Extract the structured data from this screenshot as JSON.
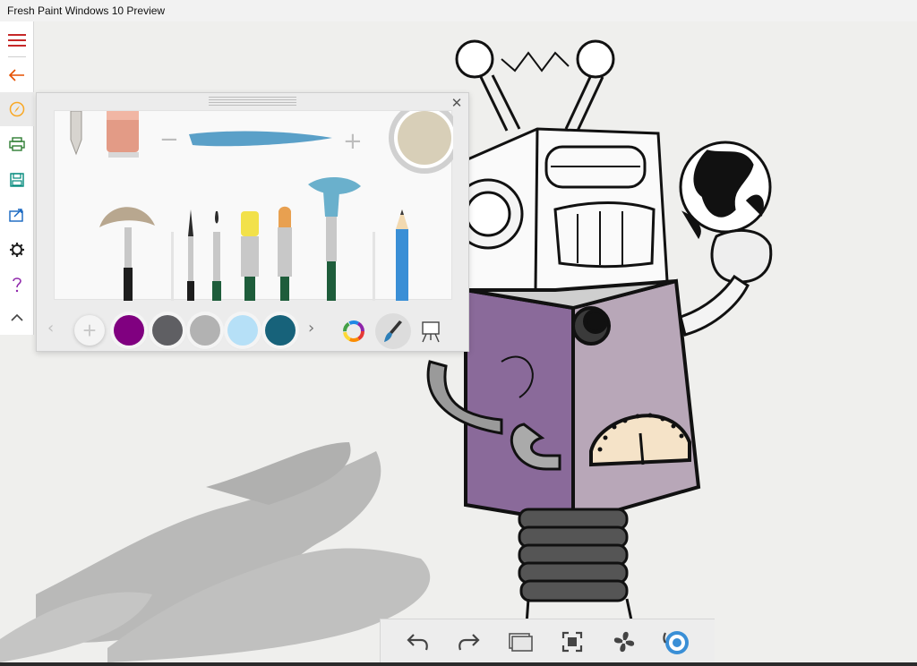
{
  "window": {
    "title": "Fresh Paint Windows 10 Preview"
  },
  "sidebar": {
    "items": [
      {
        "name": "menu",
        "icon": "hamburger-menu-icon",
        "color": "#c62828"
      },
      {
        "name": "back",
        "icon": "back-arrow-icon",
        "color": "#e65100"
      },
      {
        "name": "tools",
        "icon": "compass-icon",
        "color": "#f9a825"
      },
      {
        "name": "print",
        "icon": "printer-icon",
        "color": "#2e7d32"
      },
      {
        "name": "save",
        "icon": "save-icon",
        "color": "#00897b"
      },
      {
        "name": "share",
        "icon": "share-icon",
        "color": "#1565c0"
      },
      {
        "name": "settings",
        "icon": "gear-icon",
        "color": "#222222"
      },
      {
        "name": "help",
        "icon": "question-icon",
        "color": "#8e24aa"
      },
      {
        "name": "collapse",
        "icon": "chevron-up-icon",
        "color": "#444444"
      }
    ]
  },
  "tool_panel": {
    "close_glyph": "✕",
    "selected_color": "#d8cfb8",
    "stroke_color": "#5aa0c8",
    "size_minus": "−",
    "size_plus": "+",
    "brushes": [
      {
        "name": "fan-brush",
        "tip": "#b8a78f",
        "handle": "#1e1e1e"
      },
      {
        "name": "thin-brush",
        "tip": "#2b2b2b",
        "handle": "#f4f4f4"
      },
      {
        "name": "liner-brush",
        "tip": "#2b2b2b",
        "handle": "#1e5d3b"
      },
      {
        "name": "round-brush",
        "tip": "#e8e3d6",
        "handle": "#1e5d3b"
      },
      {
        "name": "flat-brush",
        "tip": "#f2e14a",
        "handle": "#1e5d3b"
      },
      {
        "name": "filbert-brush",
        "tip": "#e8a050",
        "handle": "#1e5d3b"
      },
      {
        "name": "blender-brush",
        "tip": "#6ab0cc",
        "handle": "#1e5d3b"
      },
      {
        "name": "pencil",
        "tip": "#3a3a3a",
        "handle": "#3a8fd6"
      }
    ],
    "palette": {
      "add_label": "+",
      "prev_arrow": "‹",
      "next_arrow": "›",
      "colors": [
        "#800080",
        "#5f5f63",
        "#b2b2b2",
        "#b6e0f7",
        "#17627a"
      ]
    }
  },
  "bottom_toolbar": {
    "buttons": [
      {
        "name": "undo",
        "icon": "undo-icon"
      },
      {
        "name": "redo",
        "icon": "redo-icon"
      },
      {
        "name": "canvas",
        "icon": "canvas-icon"
      },
      {
        "name": "fit",
        "icon": "fit-screen-icon"
      },
      {
        "name": "fan",
        "icon": "fan-dry-icon"
      },
      {
        "name": "orientation",
        "icon": "orientation-icon"
      }
    ]
  }
}
